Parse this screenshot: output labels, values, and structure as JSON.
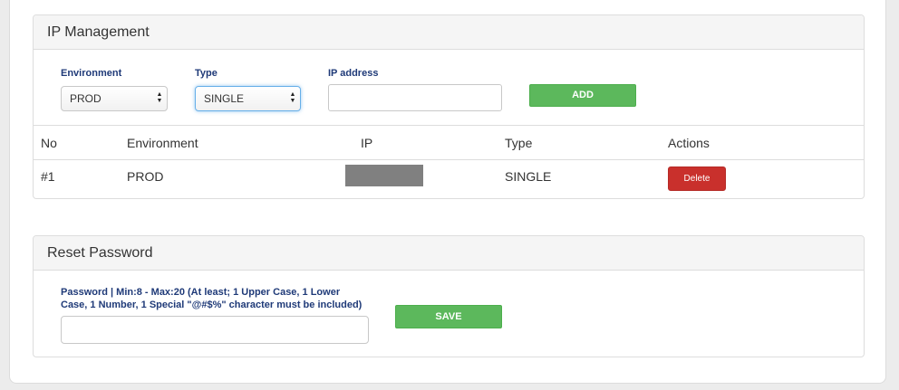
{
  "ip_management": {
    "title": "IP Management",
    "environment_label": "Environment",
    "environment_value": "PROD",
    "type_label": "Type",
    "type_value": "SINGLE",
    "ip_label": "IP address",
    "ip_value": "",
    "add_label": "ADD",
    "table": {
      "headers": [
        "No",
        "Environment",
        "IP",
        "Type",
        "Actions"
      ],
      "rows": [
        {
          "no": "#1",
          "environment": "PROD",
          "ip": "",
          "type": "SINGLE",
          "action": "Delete"
        }
      ]
    }
  },
  "reset_password": {
    "title": "Reset Password",
    "label_line1": "Password | Min:8 - Max:20 (At least; 1 Upper Case, 1 Lower",
    "label_line2": "Case, 1 Number, 1 Special \"@#$%\" character must be included)",
    "password_value": "",
    "save_label": "SAVE"
  },
  "colors": {
    "primary_button": "#5cb85c",
    "danger_button": "#c9302c",
    "label_text": "#1f3a78",
    "redacted": "#808080"
  },
  "icons": {
    "select_arrows": "up-down-chevrons-icon"
  }
}
